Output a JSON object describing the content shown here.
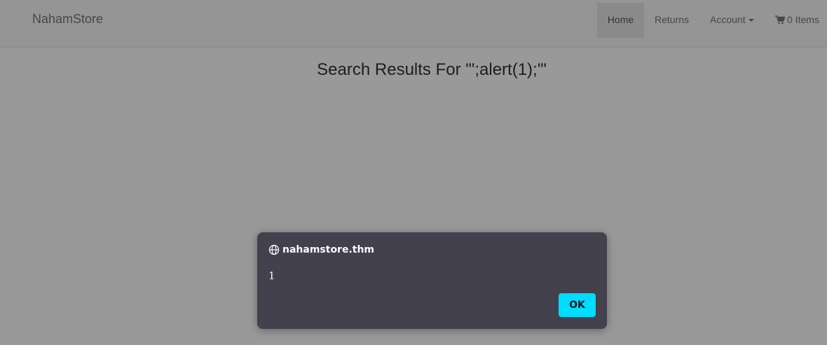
{
  "navbar": {
    "brand": "NahamStore",
    "home_label": "Home",
    "returns_label": "Returns",
    "account_label": "Account",
    "cart_label": "0 Items",
    "cart_icon": "shopping-cart-icon"
  },
  "main": {
    "search_title": "Search Results For \"';alert(1);'\""
  },
  "dialog": {
    "origin": "nahamstore.thm",
    "origin_icon": "globe-icon",
    "message": "1",
    "ok_label": "OK",
    "accent_color": "#00ddff",
    "background_color": "#42414d"
  }
}
